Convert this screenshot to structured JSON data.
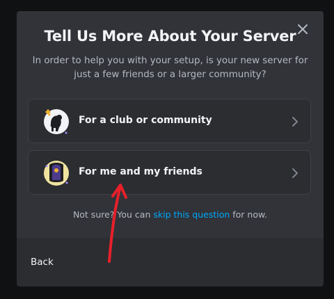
{
  "modal": {
    "title": "Tell Us More About Your Server",
    "subtitle": "In order to help you with your setup, is your new server for just a few friends or a larger community?",
    "close_icon": "close-icon"
  },
  "options": [
    {
      "label": "For a club or community",
      "icon": "club-community-icon"
    },
    {
      "label": "For me and my friends",
      "icon": "friends-icon"
    }
  ],
  "hint": {
    "prefix": "Not sure? You can ",
    "link": "skip this question",
    "suffix": " for now."
  },
  "footer": {
    "back_label": "Back"
  },
  "colors": {
    "modal_bg": "#313338",
    "card_bg": "#2b2d31",
    "link": "#00a8fc",
    "annotation_red": "#e8202a"
  }
}
